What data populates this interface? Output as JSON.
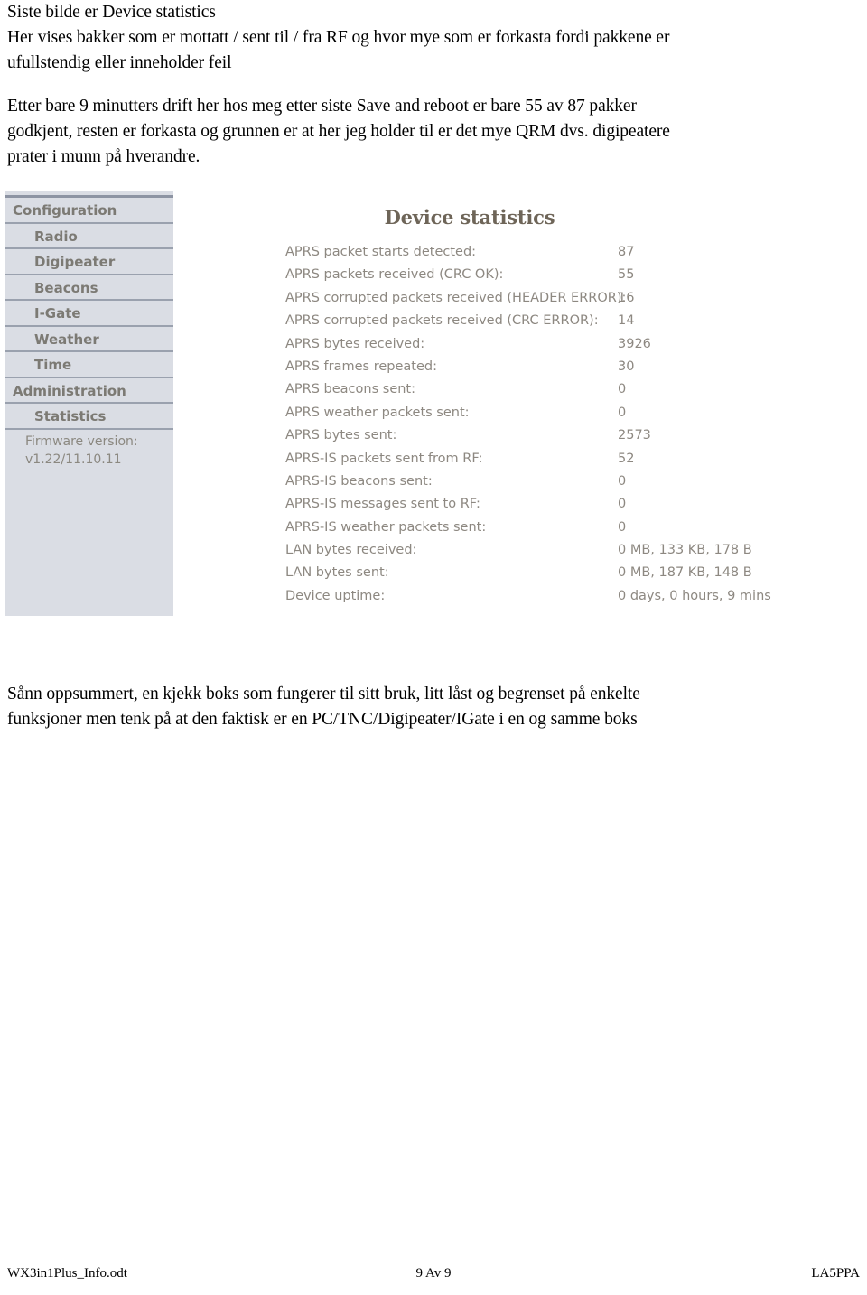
{
  "document": {
    "intro_lines": [
      "Siste bilde er Device statistics",
      "Her vises bakker som er mottatt / sent til / fra RF og hvor mye som er forkasta fordi pakkene er",
      "ufullstendig eller inneholder feil"
    ],
    "second_lines": [
      "Etter bare 9 minutters drift her hos meg etter siste Save and reboot er bare 55 av 87 pakker",
      "godkjent, resten er forkasta og grunnen er at her jeg holder til er det mye QRM dvs. digipeatere",
      "prater i munn på hverandre."
    ],
    "closing_lines": [
      "Sånn oppsummert, en kjekk boks som fungerer til sitt bruk, litt låst og begrenset på enkelte",
      "funksjoner men tenk på at den faktisk er en PC/TNC/Digipeater/IGate i en og samme boks"
    ]
  },
  "webui": {
    "sidebar": {
      "items": [
        {
          "label": "Configuration",
          "level": "top"
        },
        {
          "label": "Radio",
          "level": "sub"
        },
        {
          "label": "Digipeater",
          "level": "sub"
        },
        {
          "label": "Beacons",
          "level": "sub"
        },
        {
          "label": "I-Gate",
          "level": "sub"
        },
        {
          "label": "Weather",
          "level": "sub"
        },
        {
          "label": "Time",
          "level": "sub"
        },
        {
          "label": "Administration",
          "level": "top"
        },
        {
          "label": "Statistics",
          "level": "sub"
        }
      ],
      "firmware_label": "Firmware version:",
      "firmware_value": "v1.22/11.10.11",
      "background_color": "#dadde4",
      "text_color": "#7c7a74"
    },
    "statistics": {
      "title": "Device statistics",
      "title_color": "#6e6558",
      "rows": [
        {
          "label": "APRS packet starts detected:",
          "value": "87"
        },
        {
          "label": "APRS packets received (CRC OK):",
          "value": "55"
        },
        {
          "label": "APRS corrupted packets received (HEADER ERROR):",
          "value": "16"
        },
        {
          "label": "APRS corrupted packets received (CRC ERROR):",
          "value": "14"
        },
        {
          "label": "APRS bytes received:",
          "value": "3926"
        },
        {
          "label": "APRS frames repeated:",
          "value": "30"
        },
        {
          "label": "APRS beacons sent:",
          "value": "0"
        },
        {
          "label": "APRS weather packets sent:",
          "value": "0"
        },
        {
          "label": "APRS bytes sent:",
          "value": "2573"
        },
        {
          "label": "APRS-IS packets sent from RF:",
          "value": "52"
        },
        {
          "label": "APRS-IS beacons sent:",
          "value": "0"
        },
        {
          "label": "APRS-IS messages sent to RF:",
          "value": "0"
        },
        {
          "label": "APRS-IS weather packets sent:",
          "value": "0"
        },
        {
          "label": "LAN bytes received:",
          "value": "0 MB, 133 KB, 178 B"
        },
        {
          "label": "LAN bytes sent:",
          "value": "0 MB, 187 KB, 148 B"
        },
        {
          "label": "Device uptime:",
          "value": "0 days, 0 hours, 9 mins"
        }
      ]
    }
  },
  "footer": {
    "left": "WX3in1Plus_Info.odt",
    "center": "9 Av 9",
    "right": "LA5PPA"
  }
}
